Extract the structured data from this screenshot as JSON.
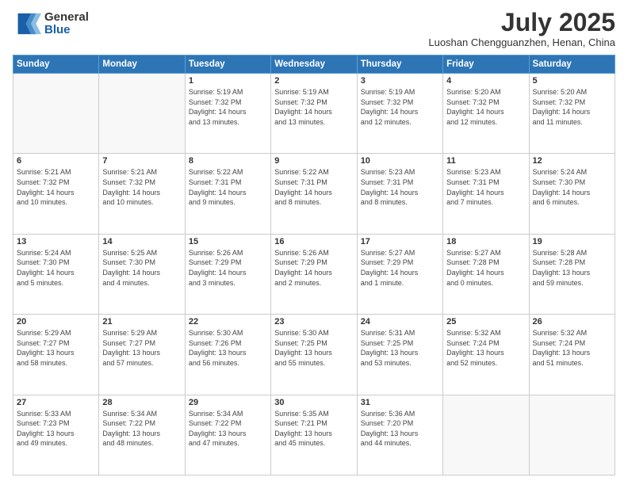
{
  "logo": {
    "line1": "General",
    "line2": "Blue"
  },
  "title": "July 2025",
  "location": "Luoshan Chengguanzhen, Henan, China",
  "days_of_week": [
    "Sunday",
    "Monday",
    "Tuesday",
    "Wednesday",
    "Thursday",
    "Friday",
    "Saturday"
  ],
  "weeks": [
    [
      {
        "day": "",
        "info": ""
      },
      {
        "day": "",
        "info": ""
      },
      {
        "day": "1",
        "info": "Sunrise: 5:19 AM\nSunset: 7:32 PM\nDaylight: 14 hours\nand 13 minutes."
      },
      {
        "day": "2",
        "info": "Sunrise: 5:19 AM\nSunset: 7:32 PM\nDaylight: 14 hours\nand 13 minutes."
      },
      {
        "day": "3",
        "info": "Sunrise: 5:19 AM\nSunset: 7:32 PM\nDaylight: 14 hours\nand 12 minutes."
      },
      {
        "day": "4",
        "info": "Sunrise: 5:20 AM\nSunset: 7:32 PM\nDaylight: 14 hours\nand 12 minutes."
      },
      {
        "day": "5",
        "info": "Sunrise: 5:20 AM\nSunset: 7:32 PM\nDaylight: 14 hours\nand 11 minutes."
      }
    ],
    [
      {
        "day": "6",
        "info": "Sunrise: 5:21 AM\nSunset: 7:32 PM\nDaylight: 14 hours\nand 10 minutes."
      },
      {
        "day": "7",
        "info": "Sunrise: 5:21 AM\nSunset: 7:32 PM\nDaylight: 14 hours\nand 10 minutes."
      },
      {
        "day": "8",
        "info": "Sunrise: 5:22 AM\nSunset: 7:31 PM\nDaylight: 14 hours\nand 9 minutes."
      },
      {
        "day": "9",
        "info": "Sunrise: 5:22 AM\nSunset: 7:31 PM\nDaylight: 14 hours\nand 8 minutes."
      },
      {
        "day": "10",
        "info": "Sunrise: 5:23 AM\nSunset: 7:31 PM\nDaylight: 14 hours\nand 8 minutes."
      },
      {
        "day": "11",
        "info": "Sunrise: 5:23 AM\nSunset: 7:31 PM\nDaylight: 14 hours\nand 7 minutes."
      },
      {
        "day": "12",
        "info": "Sunrise: 5:24 AM\nSunset: 7:30 PM\nDaylight: 14 hours\nand 6 minutes."
      }
    ],
    [
      {
        "day": "13",
        "info": "Sunrise: 5:24 AM\nSunset: 7:30 PM\nDaylight: 14 hours\nand 5 minutes."
      },
      {
        "day": "14",
        "info": "Sunrise: 5:25 AM\nSunset: 7:30 PM\nDaylight: 14 hours\nand 4 minutes."
      },
      {
        "day": "15",
        "info": "Sunrise: 5:26 AM\nSunset: 7:29 PM\nDaylight: 14 hours\nand 3 minutes."
      },
      {
        "day": "16",
        "info": "Sunrise: 5:26 AM\nSunset: 7:29 PM\nDaylight: 14 hours\nand 2 minutes."
      },
      {
        "day": "17",
        "info": "Sunrise: 5:27 AM\nSunset: 7:29 PM\nDaylight: 14 hours\nand 1 minute."
      },
      {
        "day": "18",
        "info": "Sunrise: 5:27 AM\nSunset: 7:28 PM\nDaylight: 14 hours\nand 0 minutes."
      },
      {
        "day": "19",
        "info": "Sunrise: 5:28 AM\nSunset: 7:28 PM\nDaylight: 13 hours\nand 59 minutes."
      }
    ],
    [
      {
        "day": "20",
        "info": "Sunrise: 5:29 AM\nSunset: 7:27 PM\nDaylight: 13 hours\nand 58 minutes."
      },
      {
        "day": "21",
        "info": "Sunrise: 5:29 AM\nSunset: 7:27 PM\nDaylight: 13 hours\nand 57 minutes."
      },
      {
        "day": "22",
        "info": "Sunrise: 5:30 AM\nSunset: 7:26 PM\nDaylight: 13 hours\nand 56 minutes."
      },
      {
        "day": "23",
        "info": "Sunrise: 5:30 AM\nSunset: 7:25 PM\nDaylight: 13 hours\nand 55 minutes."
      },
      {
        "day": "24",
        "info": "Sunrise: 5:31 AM\nSunset: 7:25 PM\nDaylight: 13 hours\nand 53 minutes."
      },
      {
        "day": "25",
        "info": "Sunrise: 5:32 AM\nSunset: 7:24 PM\nDaylight: 13 hours\nand 52 minutes."
      },
      {
        "day": "26",
        "info": "Sunrise: 5:32 AM\nSunset: 7:24 PM\nDaylight: 13 hours\nand 51 minutes."
      }
    ],
    [
      {
        "day": "27",
        "info": "Sunrise: 5:33 AM\nSunset: 7:23 PM\nDaylight: 13 hours\nand 49 minutes."
      },
      {
        "day": "28",
        "info": "Sunrise: 5:34 AM\nSunset: 7:22 PM\nDaylight: 13 hours\nand 48 minutes."
      },
      {
        "day": "29",
        "info": "Sunrise: 5:34 AM\nSunset: 7:22 PM\nDaylight: 13 hours\nand 47 minutes."
      },
      {
        "day": "30",
        "info": "Sunrise: 5:35 AM\nSunset: 7:21 PM\nDaylight: 13 hours\nand 45 minutes."
      },
      {
        "day": "31",
        "info": "Sunrise: 5:36 AM\nSunset: 7:20 PM\nDaylight: 13 hours\nand 44 minutes."
      },
      {
        "day": "",
        "info": ""
      },
      {
        "day": "",
        "info": ""
      }
    ]
  ]
}
